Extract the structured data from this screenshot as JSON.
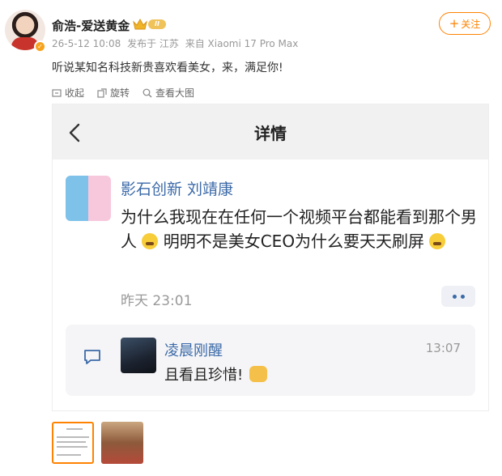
{
  "user": {
    "name": "俞浩-爱送黄金",
    "level_badge": "II",
    "avatar_icon": "avatar-photo"
  },
  "meta": {
    "timestamp": "26-5-12 10:08",
    "location": "发布于 江苏",
    "device": "来自 Xiaomi 17 Pro Max"
  },
  "follow_label": "关注",
  "post_text": "听说某知名科技新贵喜欢看美女，来，满足你!",
  "image_tools": {
    "collapse": "收起",
    "rotate": "旋转",
    "view_large": "查看大图"
  },
  "screenshot": {
    "title": "详情",
    "post": {
      "author": "影石创新 刘靖康",
      "body_1": "为什么我现在在任何一个视频平台都能看到那个男人",
      "body_2": "明明不是美女CEO为什么要天天刷屏",
      "time": "昨天 23:01"
    },
    "reply": {
      "name": "凌晨刚醒",
      "time": "13:07",
      "text": "且看且珍惜!"
    }
  },
  "colors": {
    "accent": "#ff8200",
    "link_blue": "#3c6aa8",
    "muted": "#999999"
  }
}
